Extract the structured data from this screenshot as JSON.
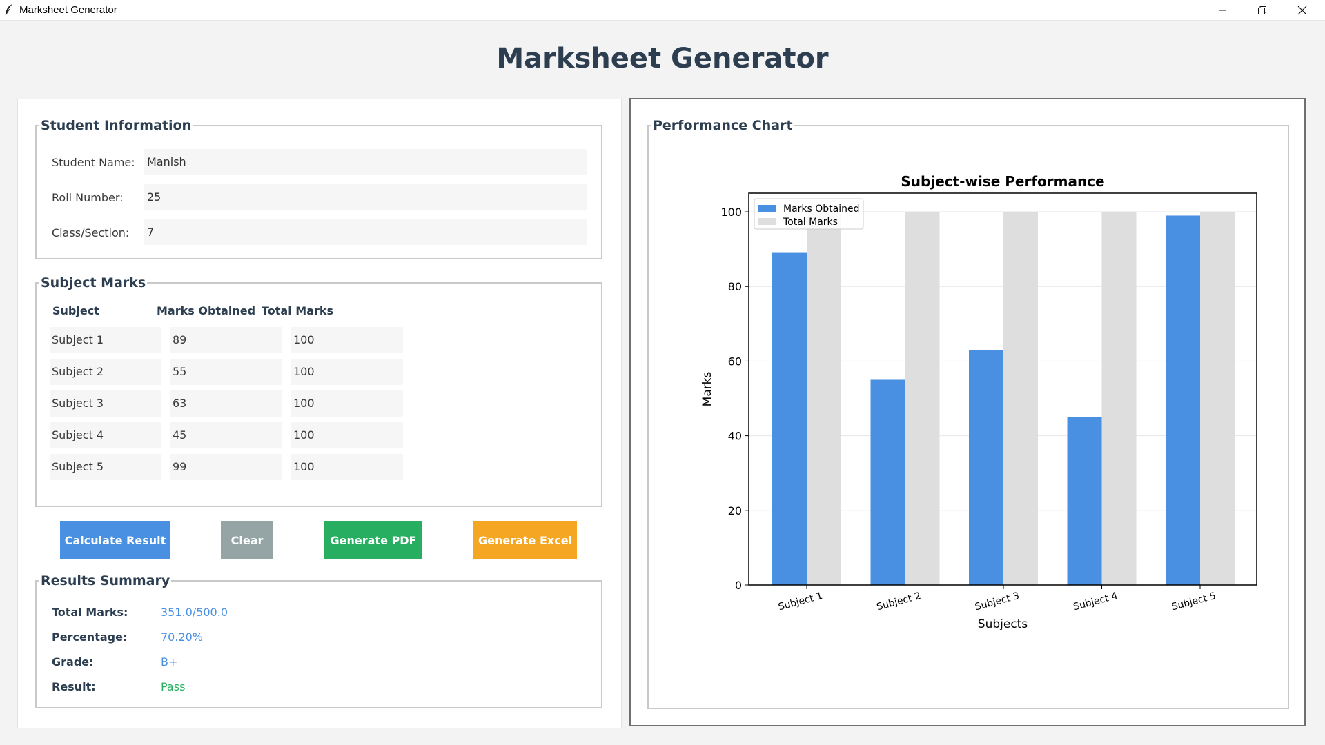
{
  "window": {
    "title": "Marksheet Generator"
  },
  "page_title": "Marksheet Generator",
  "student_info": {
    "legend": "Student Information",
    "fields": [
      {
        "label": "Student Name:",
        "value": "Manish"
      },
      {
        "label": "Roll Number:",
        "value": "25"
      },
      {
        "label": "Class/Section:",
        "value": "7"
      }
    ]
  },
  "subject_marks": {
    "legend": "Subject Marks",
    "headers": [
      "Subject",
      "Marks Obtained",
      "Total Marks"
    ],
    "rows": [
      {
        "subject": "Subject 1",
        "obtained": "89",
        "total": "100"
      },
      {
        "subject": "Subject 2",
        "obtained": "55",
        "total": "100"
      },
      {
        "subject": "Subject 3",
        "obtained": "63",
        "total": "100"
      },
      {
        "subject": "Subject 4",
        "obtained": "45",
        "total": "100"
      },
      {
        "subject": "Subject 5",
        "obtained": "99",
        "total": "100"
      }
    ]
  },
  "buttons": {
    "calculate": "Calculate Result",
    "clear": "Clear",
    "pdf": "Generate PDF",
    "excel": "Generate Excel"
  },
  "colors": {
    "calculate": "#4a90e2",
    "clear": "#95a5a6",
    "pdf": "#27ae60",
    "excel": "#f5a623",
    "value_blue": "#4a90e2",
    "pass_green": "#27ae60"
  },
  "results": {
    "legend": "Results Summary",
    "total_label": "Total Marks:",
    "total_value": "351.0/500.0",
    "percentage_label": "Percentage:",
    "percentage_value": "70.20%",
    "grade_label": "Grade:",
    "grade_value": "B+",
    "result_label": "Result:",
    "result_value": "Pass"
  },
  "chart_panel": {
    "legend": "Performance Chart"
  },
  "chart_data": {
    "type": "bar",
    "title": "Subject-wise Performance",
    "xlabel": "Subjects",
    "ylabel": "Marks",
    "categories": [
      "Subject 1",
      "Subject 2",
      "Subject 3",
      "Subject 4",
      "Subject 5"
    ],
    "series": [
      {
        "name": "Marks Obtained",
        "values": [
          89,
          55,
          63,
          45,
          99
        ],
        "color": "#4a90e2"
      },
      {
        "name": "Total Marks",
        "values": [
          100,
          100,
          100,
          100,
          100
        ],
        "color": "#dedede"
      }
    ],
    "ylim": [
      0,
      105
    ],
    "yticks": [
      0,
      20,
      40,
      60,
      80,
      100
    ],
    "grid": "horizontal",
    "legend_position": "top-left"
  }
}
